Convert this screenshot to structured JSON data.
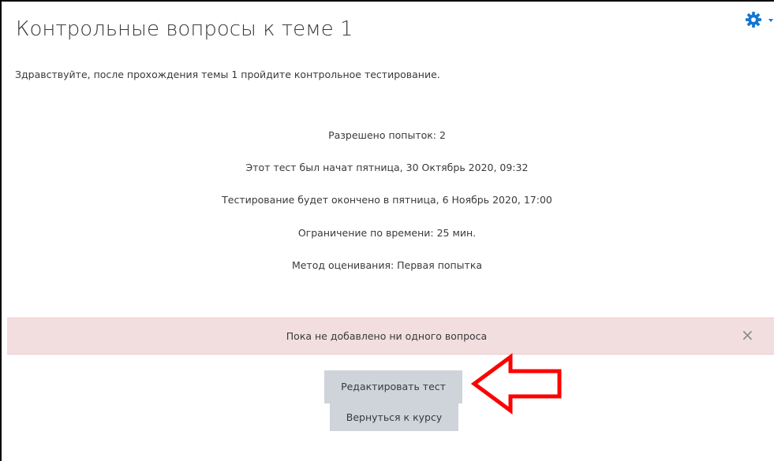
{
  "header": {
    "title": "Контрольные вопросы к теме 1",
    "settings_icon": "gear-icon",
    "settings_caret_icon": "chevron-down-icon"
  },
  "intro": {
    "text": "Здравствуйте, после прохождения темы 1 пройдите контрольное тестирование."
  },
  "quiz_info": {
    "attempts": "Разрешено попыток: 2",
    "opened": "Этот тест был начат пятница, 30 Октябрь 2020, 09:32",
    "closes": "Тестирование будет окончено в пятница, 6 Ноябрь 2020, 17:00",
    "time_limit": "Ограничение по времени: 25 мин.",
    "grading_method": "Метод оценивания: Первая попытка"
  },
  "alert": {
    "text": "Пока не добавлено ни одного вопроса",
    "close_label": "×",
    "background": "#f2dede"
  },
  "actions": {
    "edit_label": "Редактировать тест",
    "back_label": "Вернуться к курсу"
  },
  "annotation": {
    "arrow_icon": "arrow-left-icon",
    "color": "#ff0000"
  },
  "colors": {
    "accent": "#1177d1",
    "button_bg": "#ced4da",
    "text": "#373a3c"
  }
}
